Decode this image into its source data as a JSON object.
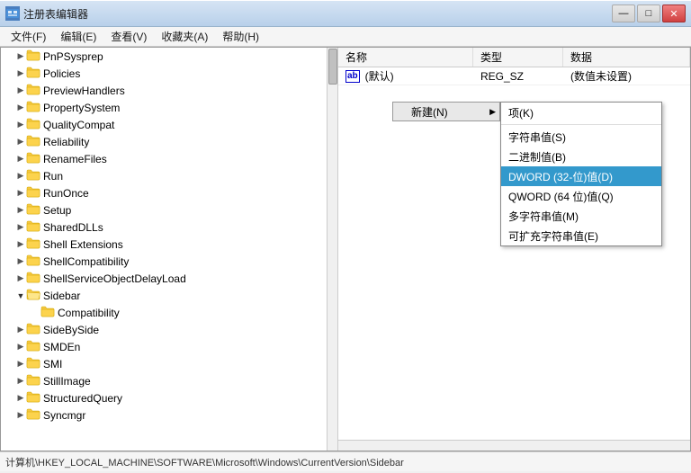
{
  "window": {
    "title": "注册表编辑器",
    "icon": "regedit-icon"
  },
  "titleButtons": {
    "minimize": "—",
    "maximize": "□",
    "close": "✕"
  },
  "menuBar": {
    "items": [
      {
        "id": "file",
        "label": "文件(F)"
      },
      {
        "id": "edit",
        "label": "编辑(E)"
      },
      {
        "id": "view",
        "label": "查看(V)"
      },
      {
        "id": "favorites",
        "label": "收藏夹(A)"
      },
      {
        "id": "help",
        "label": "帮助(H)"
      }
    ]
  },
  "treePanel": {
    "items": [
      {
        "id": "pnpsysprep",
        "label": "PnPSysprep",
        "indent": 2,
        "arrow": "▶",
        "open": false
      },
      {
        "id": "policies",
        "label": "Policies",
        "indent": 2,
        "arrow": "▶",
        "open": false
      },
      {
        "id": "previewhandlers",
        "label": "PreviewHandlers",
        "indent": 2,
        "arrow": "▶",
        "open": false
      },
      {
        "id": "propertysystem",
        "label": "PropertySystem",
        "indent": 2,
        "arrow": "▶",
        "open": false
      },
      {
        "id": "qualitycompat",
        "label": "QualityCompat",
        "indent": 2,
        "arrow": "▶",
        "open": false
      },
      {
        "id": "reliability",
        "label": "Reliability",
        "indent": 2,
        "arrow": "▶",
        "open": false
      },
      {
        "id": "renamefiles",
        "label": "RenameFiles",
        "indent": 2,
        "arrow": "▶",
        "open": false
      },
      {
        "id": "run",
        "label": "Run",
        "indent": 2,
        "arrow": "▶",
        "open": false
      },
      {
        "id": "runonce",
        "label": "RunOnce",
        "indent": 2,
        "arrow": "▶",
        "open": false
      },
      {
        "id": "setup",
        "label": "Setup",
        "indent": 2,
        "arrow": "▶",
        "open": false
      },
      {
        "id": "shareddlls",
        "label": "SharedDLLs",
        "indent": 2,
        "arrow": "▶",
        "open": false
      },
      {
        "id": "shellextensions",
        "label": "Shell Extensions",
        "indent": 2,
        "arrow": "▶",
        "open": false,
        "selected": false
      },
      {
        "id": "shellcompatibility",
        "label": "ShellCompatibility",
        "indent": 2,
        "arrow": "▶",
        "open": false
      },
      {
        "id": "shellserviceobjectdelayload",
        "label": "ShellServiceObjectDelayLoad",
        "indent": 2,
        "arrow": "▶",
        "open": false
      },
      {
        "id": "sidebar",
        "label": "Sidebar",
        "indent": 2,
        "arrow": "▼",
        "open": true
      },
      {
        "id": "sidebar-compatibility",
        "label": "Compatibility",
        "indent": 4,
        "arrow": "",
        "open": false
      },
      {
        "id": "sidebyside",
        "label": "SideBySide",
        "indent": 2,
        "arrow": "▶",
        "open": false
      },
      {
        "id": "smden",
        "label": "SMDEn",
        "indent": 2,
        "arrow": "▶",
        "open": false
      },
      {
        "id": "smi",
        "label": "SMI",
        "indent": 2,
        "arrow": "▶",
        "open": false
      },
      {
        "id": "stillimage",
        "label": "StillImage",
        "indent": 2,
        "arrow": "▶",
        "open": false
      },
      {
        "id": "structuredquery",
        "label": "StructuredQuery",
        "indent": 2,
        "arrow": "▶",
        "open": false
      },
      {
        "id": "syncmgr",
        "label": "Syncmgr",
        "indent": 2,
        "arrow": "▶",
        "open": false
      }
    ]
  },
  "tableHeader": {
    "nameCol": "名称",
    "typeCol": "类型",
    "dataCol": "数据"
  },
  "tableRows": [
    {
      "name": "(默认)",
      "type": "REG_SZ",
      "data": "(数值未设置)",
      "iconType": "ab"
    }
  ],
  "contextMenu": {
    "newTrigger": "新建(N)",
    "items": [
      {
        "id": "key",
        "label": "项(K)",
        "highlighted": false
      },
      {
        "id": "divider1",
        "type": "divider"
      },
      {
        "id": "string",
        "label": "字符串值(S)",
        "highlighted": false
      },
      {
        "id": "binary",
        "label": "二进制值(B)",
        "highlighted": false
      },
      {
        "id": "dword",
        "label": "DWORD (32-位)值(D)",
        "highlighted": true
      },
      {
        "id": "qword",
        "label": "QWORD (64 位)值(Q)",
        "highlighted": false
      },
      {
        "id": "multistring",
        "label": "多字符串值(M)",
        "highlighted": false
      },
      {
        "id": "expandstring",
        "label": "可扩充字符串值(E)",
        "highlighted": false
      }
    ]
  },
  "statusBar": {
    "path": "计算机\\HKEY_LOCAL_MACHINE\\SOFTWARE\\Microsoft\\Windows\\CurrentVersion\\Sidebar"
  },
  "colors": {
    "titleBarTop": "#d6e4f4",
    "titleBarBottom": "#b8d0ea",
    "highlighted": "#3399cc",
    "treeSelected": "#3399ff",
    "folderYellow": "#f5c842"
  }
}
